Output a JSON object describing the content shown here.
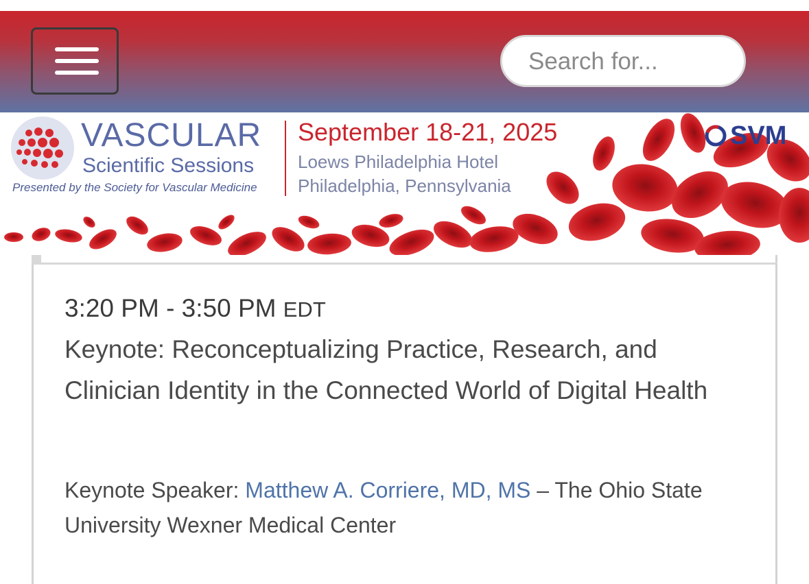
{
  "navbar": {
    "menu_icon": "hamburger-icon",
    "search_placeholder": "Search for..."
  },
  "banner": {
    "title": "VASCULAR",
    "subtitle": "Scientific Sessions",
    "presented_by": "Presented by the Society for Vascular Medicine",
    "date": "September 18-21, 2025",
    "venue": "Loews Philadelphia Hotel",
    "city": "Philadelphia, Pennsylvania",
    "org": "SVM",
    "colors": {
      "red": "#c9252d",
      "blue": "#5a6aa6",
      "navy": "#2c3e8f"
    }
  },
  "session": {
    "time": "3:20 PM - 3:50 PM",
    "timezone": "EDT",
    "title": "Keynote: Reconceptualizing Practice, Research, and Clinician Identity in the Connected World of Digital Health",
    "speaker_label": "Keynote Speaker:",
    "speaker_name": "Matthew A. Corriere, MD, MS",
    "speaker_affiliation": "– The Ohio State University Wexner Medical Center"
  }
}
